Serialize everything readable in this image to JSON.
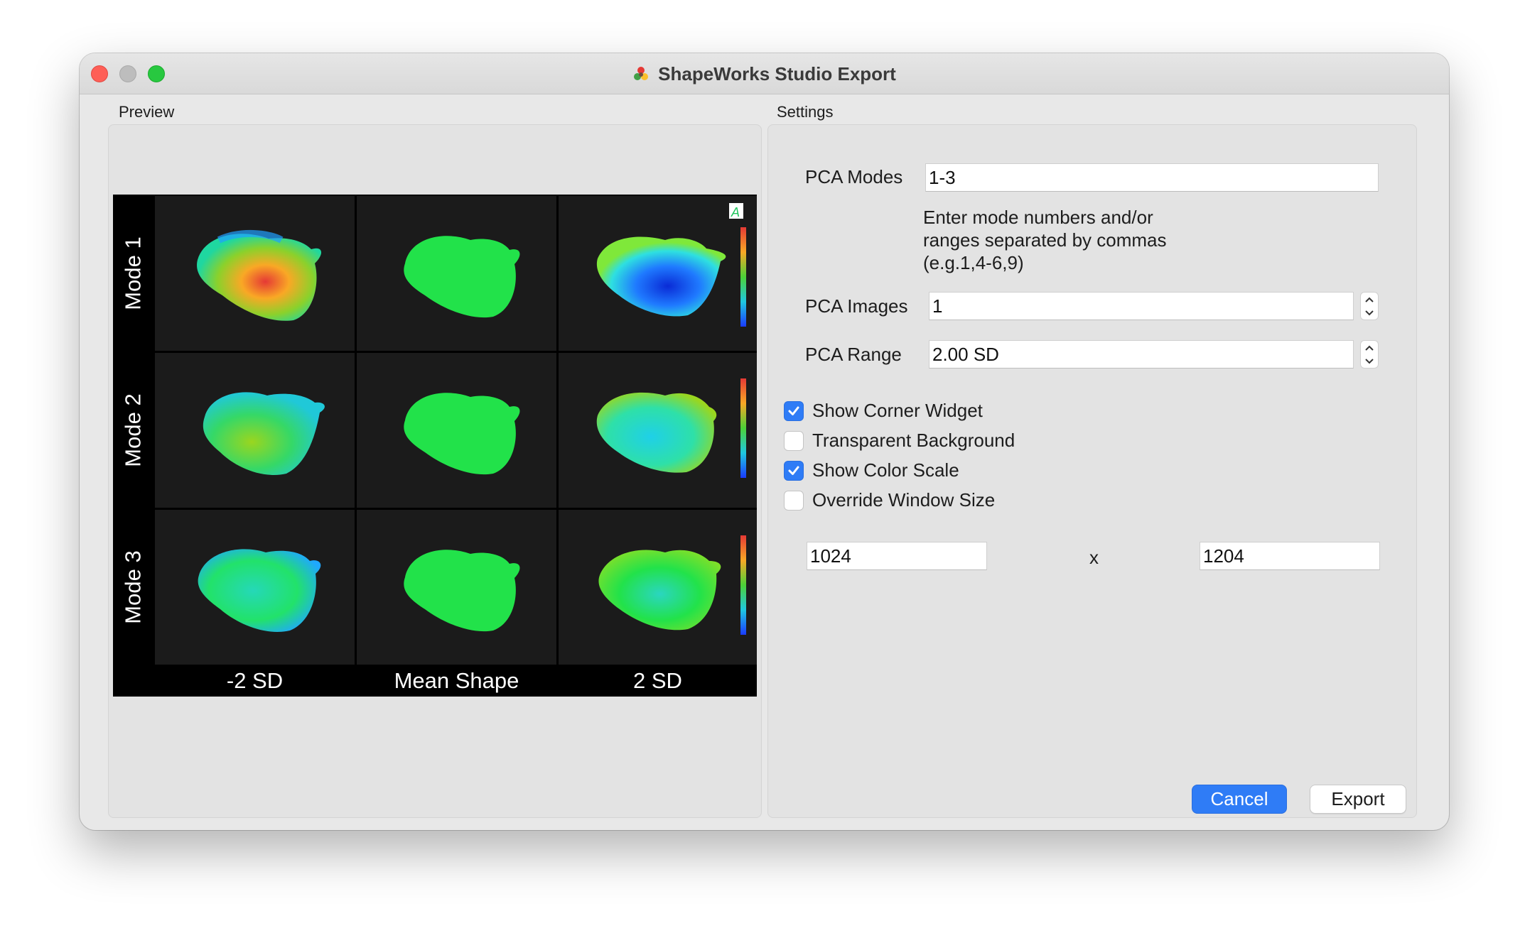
{
  "window": {
    "title": "ShapeWorks Studio Export"
  },
  "preview": {
    "group_label": "Preview",
    "rows": [
      "Mode 1",
      "Mode 2",
      "Mode 3"
    ],
    "columns": [
      "-2 SD",
      "Mean Shape",
      "2 SD"
    ]
  },
  "settings": {
    "group_label": "Settings",
    "pca_modes": {
      "label": "PCA Modes",
      "value": "1-3"
    },
    "hint_lines": [
      "Enter mode numbers and/or",
      "ranges separated by commas",
      "(e.g.1,4-6,9)"
    ],
    "pca_images": {
      "label": "PCA Images",
      "value": "1"
    },
    "pca_range": {
      "label": "PCA Range",
      "value": "2.00 SD"
    },
    "checkboxes": [
      {
        "label": "Show Corner Widget",
        "checked": true
      },
      {
        "label": "Transparent Background",
        "checked": false
      },
      {
        "label": "Show Color Scale",
        "checked": true
      },
      {
        "label": "Override Window Size",
        "checked": false
      }
    ],
    "width": "1024",
    "size_separator": "x",
    "height": "1204"
  },
  "buttons": {
    "cancel": "Cancel",
    "export": "Export"
  },
  "colors": {
    "accent": "#2f7cf6",
    "mesh_green": "#22e24a",
    "close": "#fe5f57",
    "zoom": "#28c840"
  }
}
